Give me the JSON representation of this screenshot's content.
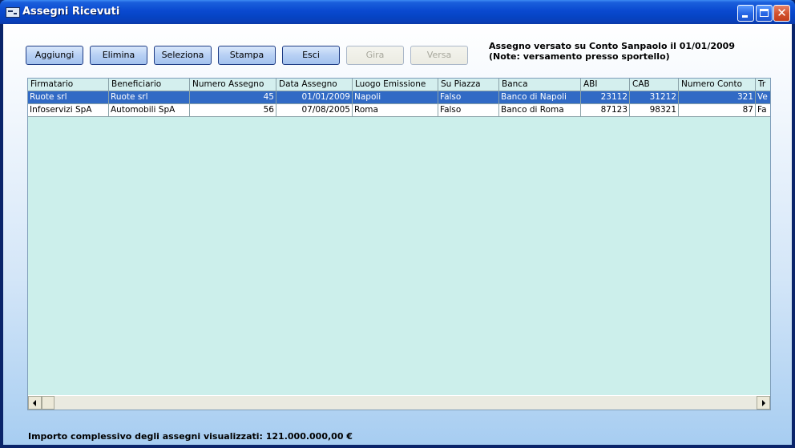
{
  "window": {
    "title": "Assegni Ricevuti"
  },
  "toolbar": {
    "buttons": [
      {
        "label": "Aggiungi",
        "enabled": true
      },
      {
        "label": "Elimina",
        "enabled": true
      },
      {
        "label": "Seleziona",
        "enabled": true
      },
      {
        "label": "Stampa",
        "enabled": true
      },
      {
        "label": "Esci",
        "enabled": true
      },
      {
        "label": "Gira",
        "enabled": false
      },
      {
        "label": "Versa",
        "enabled": false
      }
    ]
  },
  "status": {
    "line1": "Assegno versato su Conto Sanpaolo il 01/01/2009",
    "line2": "(Note: versamento presso sportello)"
  },
  "table": {
    "columns": [
      "Firmatario",
      "Beneficiario",
      "Numero Assegno",
      "Data Assegno",
      "Luogo Emissione",
      "Su Piazza",
      "Banca",
      "ABI",
      "CAB",
      "Numero Conto",
      "Tr"
    ],
    "rows": [
      [
        "Ruote srl",
        "Ruote srl",
        "45",
        "01/01/2009",
        "Napoli",
        "Falso",
        "Banco di Napoli",
        "23112",
        "31212",
        "321",
        "Ve"
      ],
      [
        "Infoservizi SpA",
        "Automobili SpA",
        "56",
        "07/08/2005",
        "Roma",
        "Falso",
        "Banco di Roma",
        "87123",
        "98321",
        "87",
        "Fa"
      ]
    ],
    "selected_row": 0
  },
  "footer": {
    "total_text": "Importo complessivo degli assegni visualizzati: 121.000.000,00 €"
  },
  "colors": {
    "titlebar": "#0a49d0",
    "selection": "#316ac5",
    "grid_bg": "#ccefeb"
  }
}
